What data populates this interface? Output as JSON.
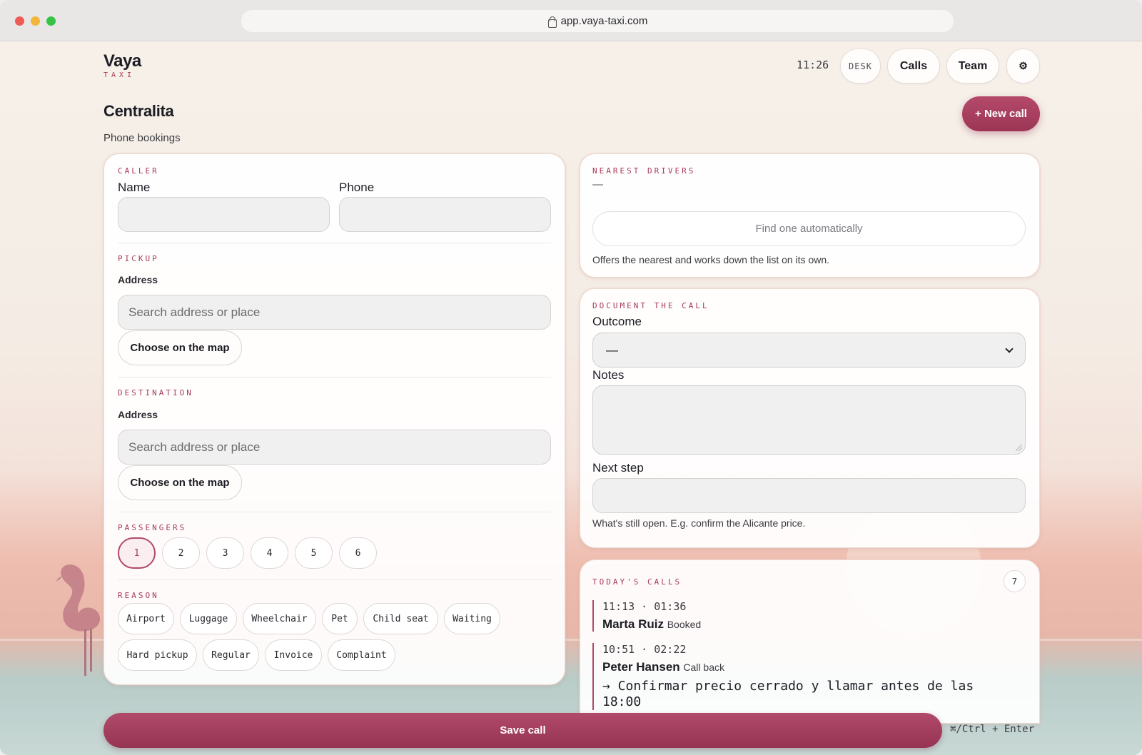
{
  "browser": {
    "url": "app.vaya-taxi.com"
  },
  "brand": {
    "name": "Vaya",
    "sub": "TAXI"
  },
  "header": {
    "clock": "11:26",
    "desk_label": "DESK",
    "calls_label": "Calls",
    "team_label": "Team",
    "settings_glyph": "⚙"
  },
  "page": {
    "title": "Centralita",
    "subtitle": "Phone bookings",
    "new_call_label": "+ New call"
  },
  "caller": {
    "section": "CALLER",
    "name_label": "Name",
    "phone_label": "Phone",
    "name_value": "",
    "phone_value": ""
  },
  "pickup": {
    "section": "PICKUP",
    "address_label": "Address",
    "placeholder": "Search address or place",
    "map_button": "Choose on the map"
  },
  "destination": {
    "section": "DESTINATION",
    "address_label": "Address",
    "placeholder": "Search address or place",
    "map_button": "Choose on the map"
  },
  "passengers": {
    "section": "PASSENGERS",
    "options": [
      "1",
      "2",
      "3",
      "4",
      "5",
      "6"
    ],
    "selected": "1"
  },
  "reason": {
    "section": "REASON",
    "chips": [
      "Airport",
      "Luggage",
      "Wheelchair",
      "Pet",
      "Child seat",
      "Waiting",
      "Hard pickup",
      "Regular",
      "Invoice",
      "Complaint"
    ]
  },
  "nearest": {
    "section": "NEAREST DRIVERS",
    "value": "—",
    "auto_button": "Find one automatically",
    "hint": "Offers the nearest and works down the list on its own."
  },
  "document": {
    "section": "DOCUMENT THE CALL",
    "outcome_label": "Outcome",
    "outcome_value": "—",
    "notes_label": "Notes",
    "next_step_label": "Next step",
    "next_step_hint": "What's still open. E.g. confirm the Alicante price."
  },
  "today": {
    "section": "TODAY'S CALLS",
    "count": "7",
    "calls": [
      {
        "time": "11:13 · 01:36",
        "name": "Marta Ruiz",
        "status": "Booked",
        "note": ""
      },
      {
        "time": "10:51 · 02:22",
        "name": "Peter Hansen",
        "status": "Call back",
        "note": "→ Confirmar precio cerrado y llamar antes de las 18:00"
      }
    ]
  },
  "footer": {
    "save_label": "Save call",
    "shortcut": "⌘/Ctrl + Enter"
  },
  "colors": {
    "accent": "#a73b5a",
    "button": "#9c3555"
  }
}
